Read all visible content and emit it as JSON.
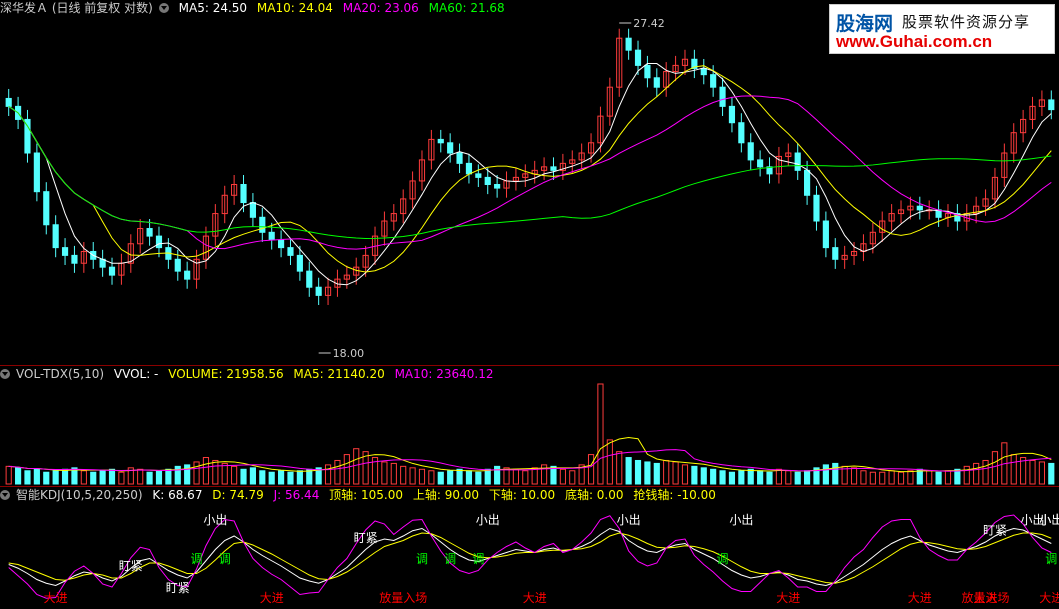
{
  "header_price": {
    "title": "深华发Ａ (日线 前复权 对数)",
    "items": [
      {
        "label": "MA5: 24.50",
        "color": "#ffffff"
      },
      {
        "label": "MA10: 24.04",
        "color": "#ffff00"
      },
      {
        "label": "MA20: 23.06",
        "color": "#ff00ff"
      },
      {
        "label": "MA60: 21.68",
        "color": "#00ff00"
      }
    ]
  },
  "header_vol": {
    "title": "VOL-TDX(5,10)",
    "items": [
      {
        "label": "VVOL: -",
        "color": "#ffffff"
      },
      {
        "label": "VOLUME: 21958.56",
        "color": "#ffff00"
      },
      {
        "label": "MA5: 21140.20",
        "color": "#ffff00"
      },
      {
        "label": "MA10: 23640.12",
        "color": "#ff00ff"
      }
    ]
  },
  "header_kdj": {
    "title": "智能KDJ(10,5,20,250)",
    "items": [
      {
        "label": "K: 68.67",
        "color": "#ffffff"
      },
      {
        "label": "D: 74.79",
        "color": "#ffff00"
      },
      {
        "label": "J: 56.44",
        "color": "#ff00ff"
      },
      {
        "label": "顶轴: 105.00",
        "color": "#ffff00"
      },
      {
        "label": "上轴: 90.00",
        "color": "#ffff00"
      },
      {
        "label": "下轴: 10.00",
        "color": "#ffff00"
      },
      {
        "label": "底轴: 0.00",
        "color": "#ffff00"
      },
      {
        "label": "抢钱轴: -10.00",
        "color": "#ffff00"
      }
    ]
  },
  "watermark": {
    "line1": "股海网",
    "line2": "股票软件资源分享",
    "line3": "www.Guhai.com.cn"
  },
  "chart_data": [
    {
      "type": "candlestick",
      "title": "深华发Ａ (日线 前复权 对数)",
      "ylim": [
        18.0,
        27.42
      ],
      "annotations": [
        {
          "label": "27.42",
          "value": 27.42
        },
        {
          "label": "18.00",
          "value": 18.0
        }
      ],
      "close": [
        24.6,
        24.2,
        23.2,
        22.1,
        21.2,
        20.6,
        20.4,
        20.2,
        20.5,
        20.3,
        20.1,
        19.9,
        20.2,
        20.7,
        21.1,
        20.9,
        20.6,
        20.3,
        20.0,
        19.8,
        20.3,
        20.9,
        21.5,
        22.0,
        22.3,
        21.8,
        21.4,
        21.0,
        20.8,
        20.6,
        20.4,
        20.0,
        19.6,
        19.4,
        19.6,
        19.8,
        19.9,
        20.1,
        20.4,
        20.9,
        21.3,
        21.5,
        21.9,
        22.4,
        23.0,
        23.6,
        23.5,
        23.2,
        22.9,
        22.6,
        22.5,
        22.3,
        22.2,
        22.4,
        22.5,
        22.6,
        22.7,
        22.8,
        22.7,
        22.9,
        23.0,
        23.2,
        23.5,
        24.3,
        25.2,
        26.8,
        26.4,
        25.9,
        25.5,
        25.2,
        25.7,
        25.9,
        26.1,
        25.8,
        25.6,
        25.2,
        24.6,
        24.1,
        23.5,
        23.0,
        22.8,
        22.6,
        23.1,
        23.2,
        22.7,
        22.0,
        21.3,
        20.6,
        20.3,
        20.4,
        20.5,
        20.7,
        21.0,
        21.3,
        21.5,
        21.6,
        21.7,
        21.6,
        21.6,
        21.4,
        21.5,
        21.3,
        21.5,
        21.7,
        21.9,
        22.5,
        23.2,
        23.8,
        24.2,
        24.6,
        24.8,
        24.5
      ]
    },
    {
      "type": "bar",
      "title": "VOL-TDX(5,10)",
      "values": [
        12,
        11,
        9,
        10,
        8,
        9,
        10,
        11,
        9,
        8,
        9,
        10,
        8,
        11,
        10,
        8,
        9,
        10,
        12,
        13,
        15,
        18,
        16,
        14,
        12,
        10,
        11,
        9,
        8,
        9,
        8,
        9,
        10,
        11,
        13,
        16,
        20,
        24,
        22,
        18,
        15,
        14,
        12,
        11,
        10,
        9,
        8,
        9,
        10,
        9,
        8,
        10,
        12,
        11,
        10,
        9,
        11,
        13,
        12,
        10,
        9,
        13,
        20,
        68,
        30,
        22,
        18,
        16,
        15,
        14,
        16,
        15,
        13,
        12,
        11,
        10,
        9,
        8,
        9,
        10,
        9,
        8,
        10,
        9,
        8,
        9,
        11,
        13,
        14,
        12,
        11,
        9,
        8,
        8,
        9,
        8,
        9,
        10,
        9,
        8,
        9,
        10,
        12,
        14,
        16,
        22,
        28,
        20,
        18,
        16,
        15,
        14
      ]
    },
    {
      "type": "line",
      "title": "智能KDJ(10,5,20,250)",
      "series": [
        {
          "name": "K",
          "values": [
            40,
            35,
            28,
            20,
            15,
            12,
            18,
            25,
            30,
            28,
            22,
            18,
            24,
            35,
            45,
            48,
            40,
            32,
            26,
            22,
            30,
            45,
            60,
            72,
            78,
            70,
            60,
            52,
            45,
            38,
            30,
            22,
            18,
            15,
            20,
            28,
            36,
            48,
            60,
            70,
            74,
            72,
            78,
            85,
            88,
            80,
            70,
            60,
            52,
            46,
            44,
            48,
            52,
            56,
            60,
            58,
            56,
            60,
            62,
            58,
            60,
            64,
            70,
            80,
            88,
            84,
            72,
            64,
            58,
            56,
            62,
            66,
            68,
            60,
            54,
            48,
            40,
            32,
            26,
            22,
            24,
            28,
            30,
            26,
            20,
            18,
            14,
            12,
            16,
            24,
            32,
            40,
            50,
            60,
            68,
            74,
            78,
            72,
            66,
            62,
            58,
            56,
            60,
            64,
            70,
            78,
            84,
            88,
            86,
            80,
            74,
            68
          ]
        },
        {
          "name": "D",
          "values": [
            42,
            40,
            35,
            30,
            25,
            20,
            19,
            22,
            26,
            28,
            26,
            22,
            22,
            28,
            36,
            42,
            42,
            38,
            33,
            28,
            28,
            35,
            46,
            58,
            68,
            70,
            66,
            60,
            54,
            47,
            40,
            33,
            26,
            21,
            20,
            24,
            30,
            38,
            47,
            56,
            64,
            68,
            72,
            78,
            82,
            81,
            76,
            69,
            62,
            55,
            50,
            49,
            50,
            52,
            55,
            56,
            56,
            58,
            59,
            59,
            60,
            61,
            64,
            70,
            78,
            82,
            79,
            74,
            68,
            63,
            62,
            63,
            65,
            64,
            61,
            57,
            51,
            44,
            37,
            31,
            28,
            28,
            29,
            28,
            25,
            22,
            19,
            16,
            15,
            18,
            23,
            30,
            37,
            45,
            53,
            61,
            67,
            70,
            69,
            67,
            64,
            61,
            60,
            61,
            64,
            69,
            74,
            79,
            82,
            82,
            80,
            75
          ]
        },
        {
          "name": "J",
          "values": [
            36,
            25,
            14,
            0,
            -5,
            -4,
            16,
            31,
            38,
            28,
            14,
            10,
            28,
            49,
            63,
            60,
            36,
            20,
            12,
            10,
            34,
            65,
            88,
            100,
            98,
            70,
            48,
            36,
            27,
            20,
            10,
            0,
            2,
            3,
            20,
            36,
            48,
            68,
            86,
            98,
            94,
            80,
            90,
            99,
            100,
            78,
            58,
            42,
            32,
            28,
            32,
            46,
            56,
            64,
            70,
            62,
            56,
            64,
            68,
            56,
            60,
            70,
            82,
            100,
            105,
            88,
            58,
            44,
            38,
            42,
            62,
            72,
            74,
            52,
            40,
            30,
            18,
            8,
            4,
            4,
            16,
            28,
            32,
            22,
            10,
            10,
            4,
            4,
            18,
            36,
            50,
            60,
            76,
            90,
            98,
            100,
            100,
            76,
            60,
            52,
            46,
            46,
            60,
            70,
            82,
            96,
            104,
            106,
            94,
            76,
            62,
            56
          ]
        }
      ],
      "signals": [
        {
          "label": "小出",
          "index": 22,
          "color": "#ffffff"
        },
        {
          "label": "小出",
          "index": 51,
          "color": "#ffffff"
        },
        {
          "label": "小出",
          "index": 66,
          "color": "#ffffff"
        },
        {
          "label": "小出",
          "index": 78,
          "color": "#ffffff"
        },
        {
          "label": "小出",
          "index": 109,
          "color": "#ffffff"
        },
        {
          "label": "小出",
          "index": 127,
          "color": "#ffffff"
        },
        {
          "label": "小出",
          "index": 133,
          "color": "#ffffff"
        },
        {
          "label": "调",
          "index": 20,
          "color": "#00ff00"
        },
        {
          "label": "调",
          "index": 23,
          "color": "#00ff00"
        },
        {
          "label": "调",
          "index": 44,
          "color": "#00ff00"
        },
        {
          "label": "调",
          "index": 47,
          "color": "#00ff00"
        },
        {
          "label": "调",
          "index": 50,
          "color": "#00ff00"
        },
        {
          "label": "调",
          "index": 76,
          "color": "#00ff00"
        },
        {
          "label": "调",
          "index": 111,
          "color": "#00ff00"
        },
        {
          "label": "盯紧",
          "index": 13,
          "color": "#ffffff"
        },
        {
          "label": "盯紧",
          "index": 18,
          "color": "#ffffff"
        },
        {
          "label": "盯紧",
          "index": 38,
          "color": "#ffffff"
        },
        {
          "label": "盯紧",
          "index": 105,
          "color": "#ffffff"
        },
        {
          "label": "大进",
          "index": 5,
          "color": "#ff0000"
        },
        {
          "label": "大进",
          "index": 28,
          "color": "#ff0000"
        },
        {
          "label": "大进",
          "index": 56,
          "color": "#ff0000"
        },
        {
          "label": "大进",
          "index": 83,
          "color": "#ff0000"
        },
        {
          "label": "大进",
          "index": 97,
          "color": "#ff0000"
        },
        {
          "label": "大进",
          "index": 118,
          "color": "#ff0000"
        },
        {
          "label": "大进",
          "index": 104,
          "color": "#ff0000"
        },
        {
          "label": "放量入场",
          "index": 42,
          "color": "#ff0000"
        },
        {
          "label": "放量入场",
          "index": 104,
          "color": "#ff0000"
        }
      ]
    }
  ]
}
